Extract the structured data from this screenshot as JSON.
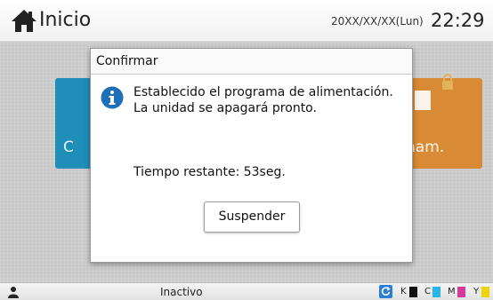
{
  "header": {
    "title": "Inicio",
    "date": "20XX/XX/XX(Lun)",
    "time": "22:29"
  },
  "tiles": {
    "left_label": "C",
    "right_label": "nam."
  },
  "dialog": {
    "title": "Confirmar",
    "message_line1": "Establecido el programa de alimentación.",
    "message_line2": "La unidad se apagará pronto.",
    "remaining": "Tiempo restante: 53seg.",
    "button_label": "Suspender"
  },
  "statusbar": {
    "status": "Inactivo",
    "inks": [
      {
        "label": "K",
        "color": "#111111"
      },
      {
        "label": "C",
        "color": "#27b6e6"
      },
      {
        "label": "M",
        "color": "#d63a9a"
      },
      {
        "label": "Y",
        "color": "#f0d20a"
      }
    ]
  },
  "colors": {
    "tile_blue": "#1f8fb9",
    "tile_orange": "#d98a34",
    "info_blue": "#1f6fb8",
    "refresh_blue": "#2a7ed6"
  },
  "icons": {
    "home": "home-icon",
    "lock": "lock-icon",
    "info": "info-icon",
    "user": "user-icon",
    "refresh": "refresh-icon"
  }
}
